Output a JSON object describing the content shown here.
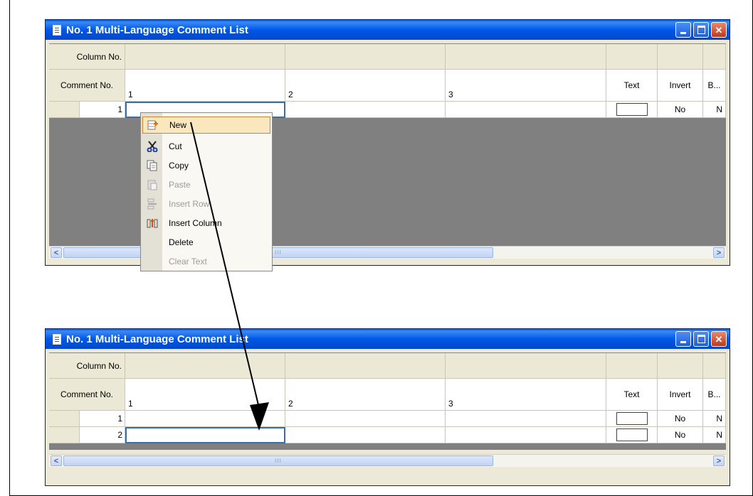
{
  "windows": [
    {
      "title": "No. 1 Multi-Language Comment List",
      "header": {
        "column_no_label": "Column No.",
        "comment_no_label": "Comment No.",
        "columns": [
          "1",
          "2",
          "3"
        ],
        "text_label": "Text",
        "invert_label": "Invert",
        "b_label": "B..."
      },
      "rows": [
        {
          "num": "1",
          "invert": "No",
          "b": "N"
        }
      ]
    },
    {
      "title": "No. 1 Multi-Language Comment List",
      "header": {
        "column_no_label": "Column No.",
        "comment_no_label": "Comment No.",
        "columns": [
          "1",
          "2",
          "3"
        ],
        "text_label": "Text",
        "invert_label": "Invert",
        "b_label": "B..."
      },
      "rows": [
        {
          "num": "1",
          "invert": "No",
          "b": "N"
        },
        {
          "num": "2",
          "invert": "No",
          "b": "N"
        }
      ]
    }
  ],
  "scrollbar": {
    "left_arrow": "<",
    "right_arrow": ">",
    "thumb_grip": "III"
  },
  "context_menu": {
    "items": [
      {
        "label": "New",
        "icon": "new-row-icon",
        "state": "highlighted"
      },
      {
        "label": "Cut",
        "icon": "scissors-icon",
        "state": "enabled"
      },
      {
        "label": "Copy",
        "icon": "copy-icon",
        "state": "enabled"
      },
      {
        "label": "Paste",
        "icon": "paste-icon",
        "state": "disabled"
      },
      {
        "label": "Insert Row",
        "icon": "insert-row-icon",
        "state": "disabled"
      },
      {
        "label": "Insert Column",
        "icon": "insert-column-icon",
        "state": "enabled"
      },
      {
        "label": "Delete",
        "icon": "",
        "state": "enabled"
      },
      {
        "label": "Clear Text",
        "icon": "",
        "state": "disabled"
      }
    ]
  },
  "colors": {
    "titlebar": "#0058e6",
    "highlight": "#fbe7bd",
    "selection": "#3a6ea8"
  }
}
